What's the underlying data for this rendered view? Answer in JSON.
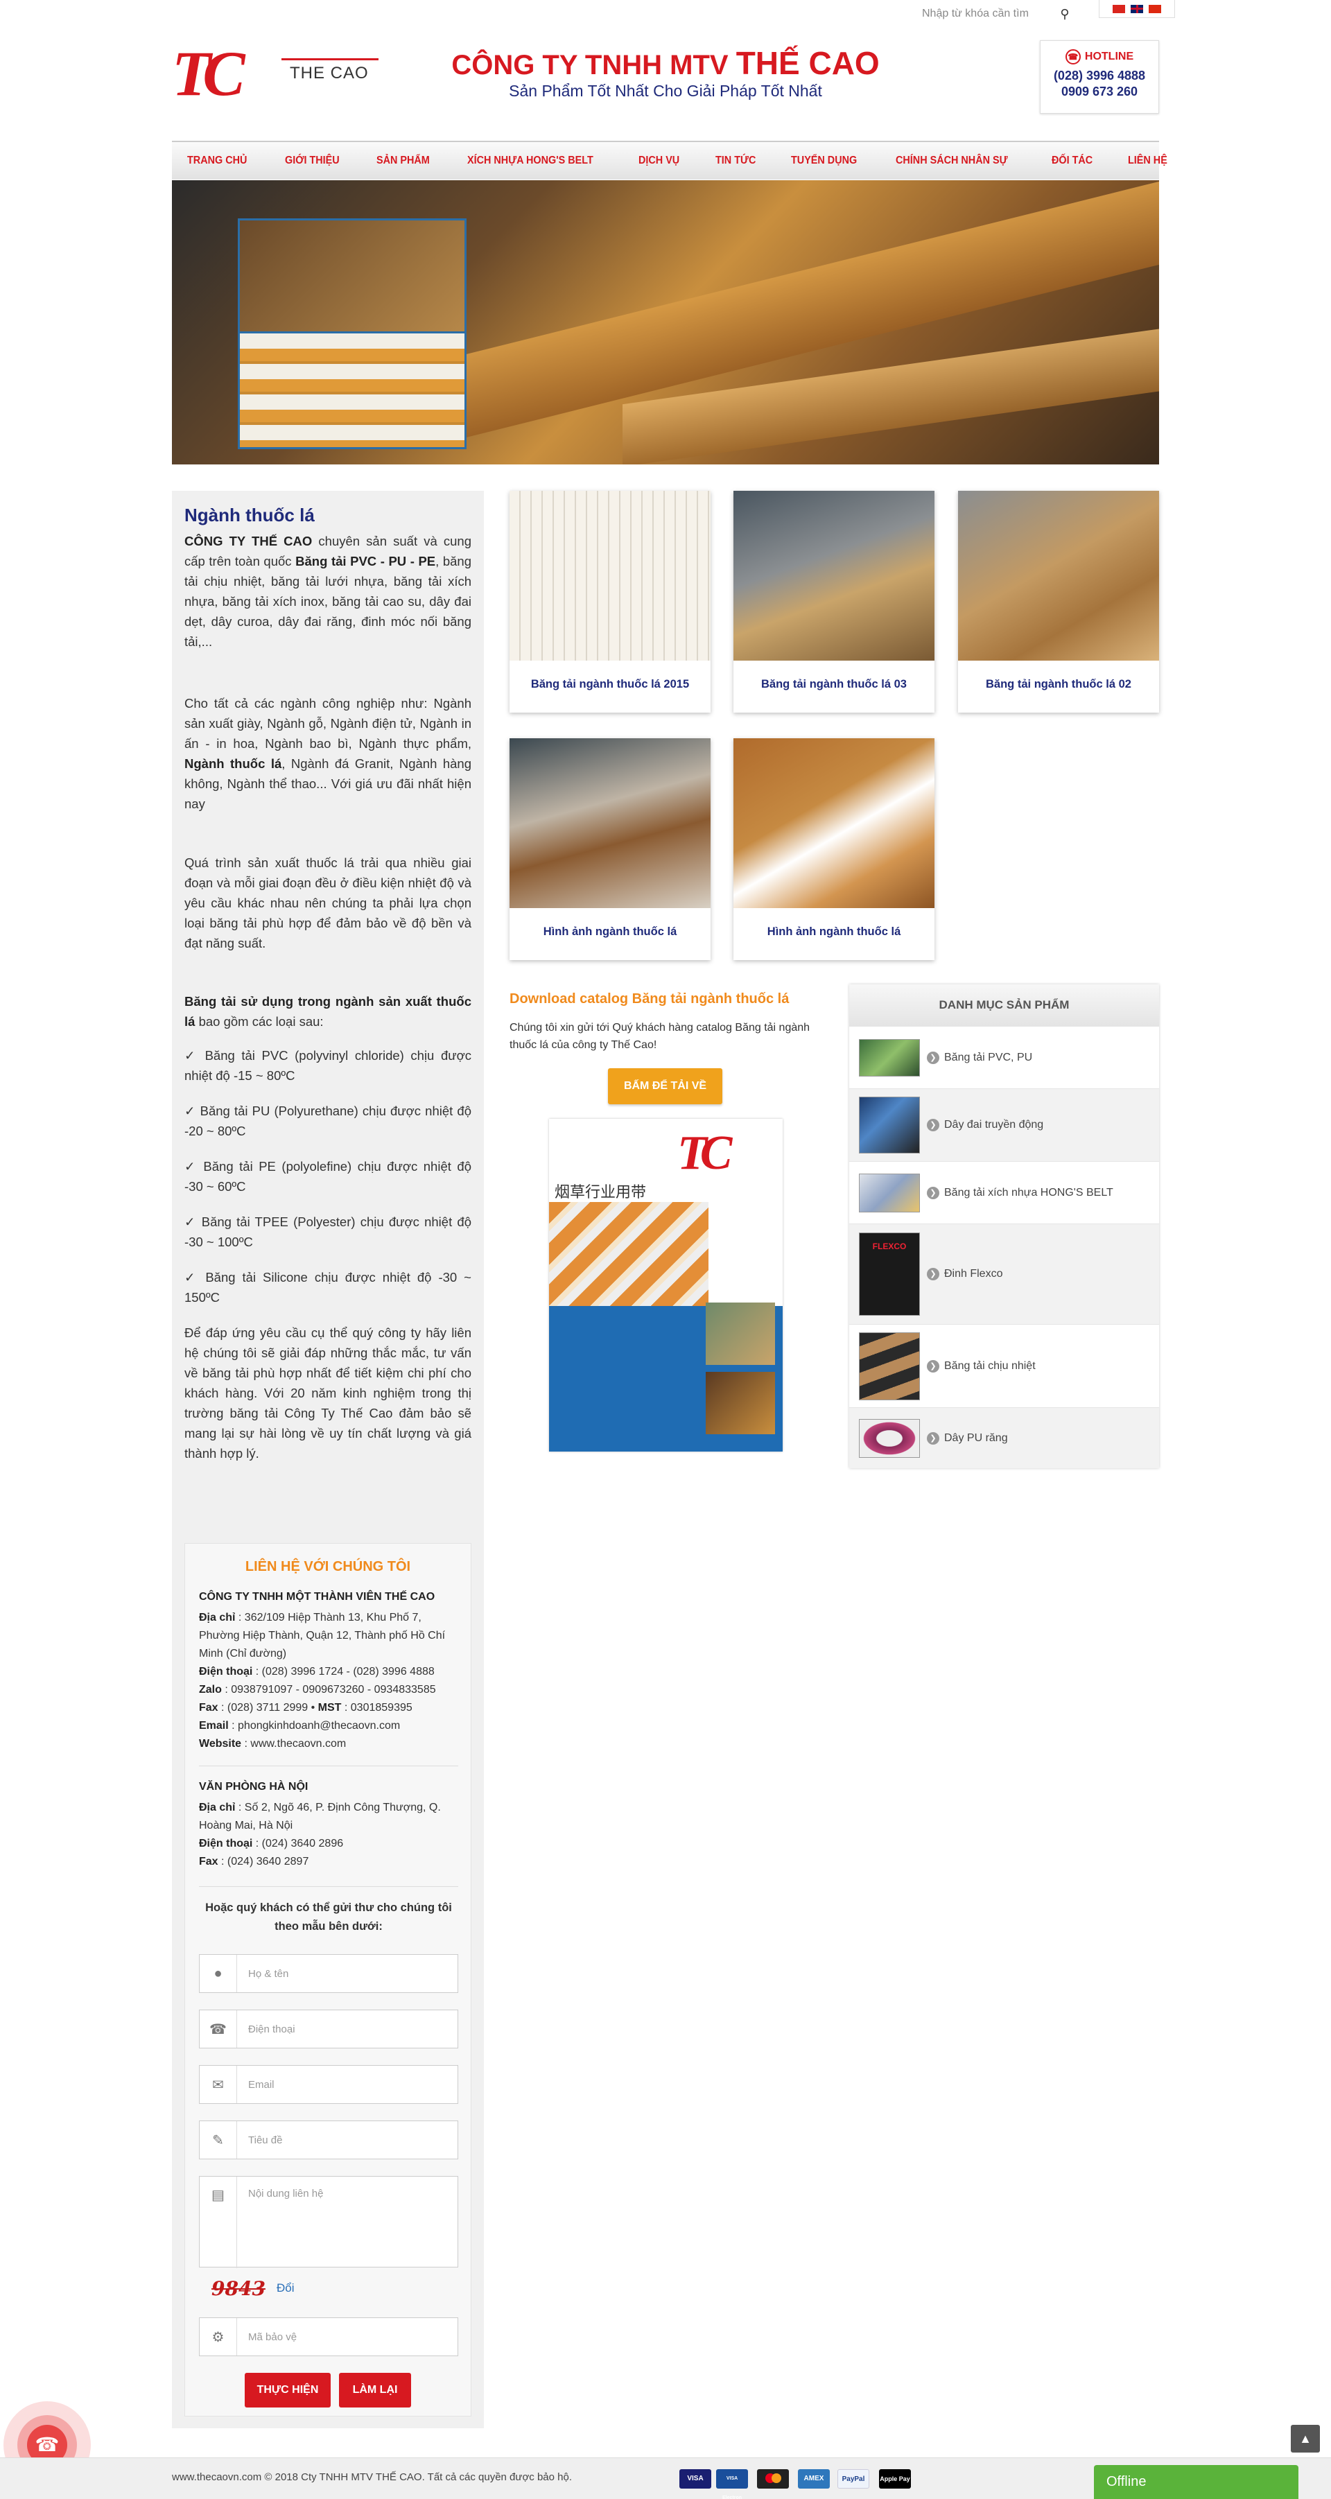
{
  "header": {
    "search_placeholder": "Nhập từ khóa cần tìm",
    "logo_mark": "TC",
    "logo_text": "THE CAO",
    "company_prefix": "CÔNG TY TNHH MTV ",
    "company_name": "THẾ CAO",
    "slogan": "Sản Phẩm Tốt Nhất Cho Giải Pháp Tốt Nhất",
    "hotline_label": "HOTLINE",
    "hotline_1": "(028) 3996 4888",
    "hotline_2": "0909 673 260"
  },
  "nav": [
    "TRANG CHỦ",
    "GIỚI THIỆU",
    "SẢN PHẨM",
    "XÍCH NHỰA HONG'S BELT",
    "DỊCH VỤ",
    "TIN TỨC",
    "TUYỂN DỤNG",
    "CHÍNH SÁCH NHÂN SỰ",
    "ĐỐI TÁC",
    "LIÊN HỆ"
  ],
  "article": {
    "title": "Ngành thuốc lá",
    "p1_a": "CÔNG TY THẾ CAO",
    "p1_b": " chuyên sản suất và cung cấp trên toàn quốc ",
    "p1_c": "Băng tải PVC - PU - PE",
    "p1_d": ", băng tải chịu nhiệt, băng tải lưới nhựa, băng tải xích nhựa, băng tải xích inox, băng tải cao su, dây đai dẹt, dây curoa, dây đai răng, đinh móc nối băng tải,...",
    "p2_a": "Cho tất cả các ngành công nghiệp như: Ngành sản xuất giày, Ngành gỗ, Ngành điện tử, Ngành in ấn - in hoa, Ngành bao bì, Ngành thực phẩm, ",
    "p2_b": "Ngành thuốc lá",
    "p2_c": ", Ngành đá Granit, Ngành hàng không, Ngành thể thao... Với giá ưu đãi nhất hiện nay",
    "p3": "Quá trình sản xuất thuốc lá trải qua nhiều giai đoạn và mỗi giai đoạn đều ở điều kiện nhiệt độ và yêu cầu khác nhau nên chúng ta phải lựa chọn loại băng tải phù hợp để đảm bảo về độ bền và đạt năng suất.",
    "p4_a": "Băng tải sử dụng trong ngành sản xuất thuốc lá",
    "p4_b": " bao gồm các loại sau:",
    "list": [
      "✓ Băng tải PVC (polyvinyl chloride) chịu được nhiệt độ -15 ~ 80ºC",
      "✓ Băng tải PU (Polyurethane) chịu được nhiệt độ -20 ~ 80ºC",
      "✓ Băng tải PE (polyolefine) chịu được nhiệt độ -30 ~ 60ºC",
      "✓ Băng tải TPEE (Polyester) chịu được nhiệt độ -30 ~ 100ºC",
      "✓ Băng tải Silicone chịu được nhiệt độ -30 ~ 150ºC"
    ],
    "p5": "Để đáp ứng yêu cầu cụ thể quý công ty hãy liên hệ chúng tôi sẽ giải đáp những thắc mắc, tư vấn về băng tải phù hợp nhất để tiết kiệm chi phí cho khách hàng. Với 20 năm kinh nghiệm trong thị trường băng tải Công Ty Thế Cao đảm bảo sẽ mang lại sự hài lòng về uy tín chất lượng và giá thành hợp lý."
  },
  "contact": {
    "title": "LIÊN HỆ VỚI CHÚNG TÔI",
    "company": "CÔNG TY TNHH MỘT THÀNH VIÊN THẾ CAO",
    "addr_label": "Địa chỉ",
    "addr": " : 362/109 Hiệp Thành 13, Khu Phố 7, Phường Hiệp Thành, Quận 12, Thành phố Hồ Chí Minh (Chỉ đường)",
    "phone_label": "Điện thoại",
    "phone": " : (028) 3996 1724  -  (028) 3996 4888",
    "zalo_label": "Zalo",
    "zalo": " : 0938791097 - 0909673260 - 0934833585",
    "fax_label": "Fax",
    "fax": " : (028) 3711 2999  •  ",
    "mst_label": "MST",
    "mst": " : 0301859395",
    "email_label": "Email",
    "email": " : phongkinhdoanh@thecaovn.com",
    "web_label": "Website",
    "web": " : www.thecaovn.com",
    "hn_title": "VĂN PHÒNG HÀ NỘI",
    "hn_addr": " : Số 2, Ngõ 46, P. Định Công Thượng, Q. Hoàng Mai, Hà Nội",
    "hn_phone": " : (024) 3640 2896",
    "hn_fax": " : (024) 3640 2897",
    "note": "Hoặc quý khách có thể gửi thư cho chúng tôi theo mẫu bên dưới:",
    "ph_name": "Họ & tên",
    "ph_phone": "Điện thoại",
    "ph_email": "Email",
    "ph_subject": "Tiêu đề",
    "ph_content": "Nội dung liên hệ",
    "captcha": "9843",
    "captcha_change": "Đổi",
    "ph_code": "Mã bảo vệ",
    "submit": "THỰC HIỆN",
    "reset": "LÀM LẠI"
  },
  "products": [
    "Băng tải ngành thuốc lá 2015",
    "Băng tải ngành thuốc lá 03",
    "Băng tải ngành thuốc lá 02",
    "Hình ảnh ngành thuốc lá",
    "Hình ảnh ngành thuốc lá"
  ],
  "catalog": {
    "title": "Download catalog Băng tải ngành thuốc lá",
    "text": "Chúng tôi xin gửi tới Quý khách hàng catalog Băng tải ngành thuốc lá của công ty Thế Cao!",
    "button": "BẤM ĐỂ TẢI VỀ",
    "cover_logo": "TC",
    "cover_cn": "烟草行业用带"
  },
  "categories": {
    "title": "DANH MỤC SẢN PHẨM",
    "items": [
      "Băng tải PVC, PU",
      "Dây đai truyền động",
      "Băng tải xích nhựa HONG'S BELT",
      "Đinh Flexco",
      "Băng tải chịu nhiệt",
      "Dây PU răng"
    ],
    "flexco_text": "FLEXCO"
  },
  "footer": {
    "copyright": "www.thecaovn.com © 2018 Cty TNHH MTV THẾ CAO. Tất cả các quyền được bảo hộ.",
    "payments": [
      "VISA",
      "VISA Electron",
      "MC",
      "AMEX",
      "PayPal",
      "Apple Pay"
    ],
    "offline": "Offline"
  },
  "colors": {
    "brand_red": "#d71920",
    "navy": "#1f2a7a",
    "orange": "#f08a1c",
    "green": "#5ab33a"
  }
}
